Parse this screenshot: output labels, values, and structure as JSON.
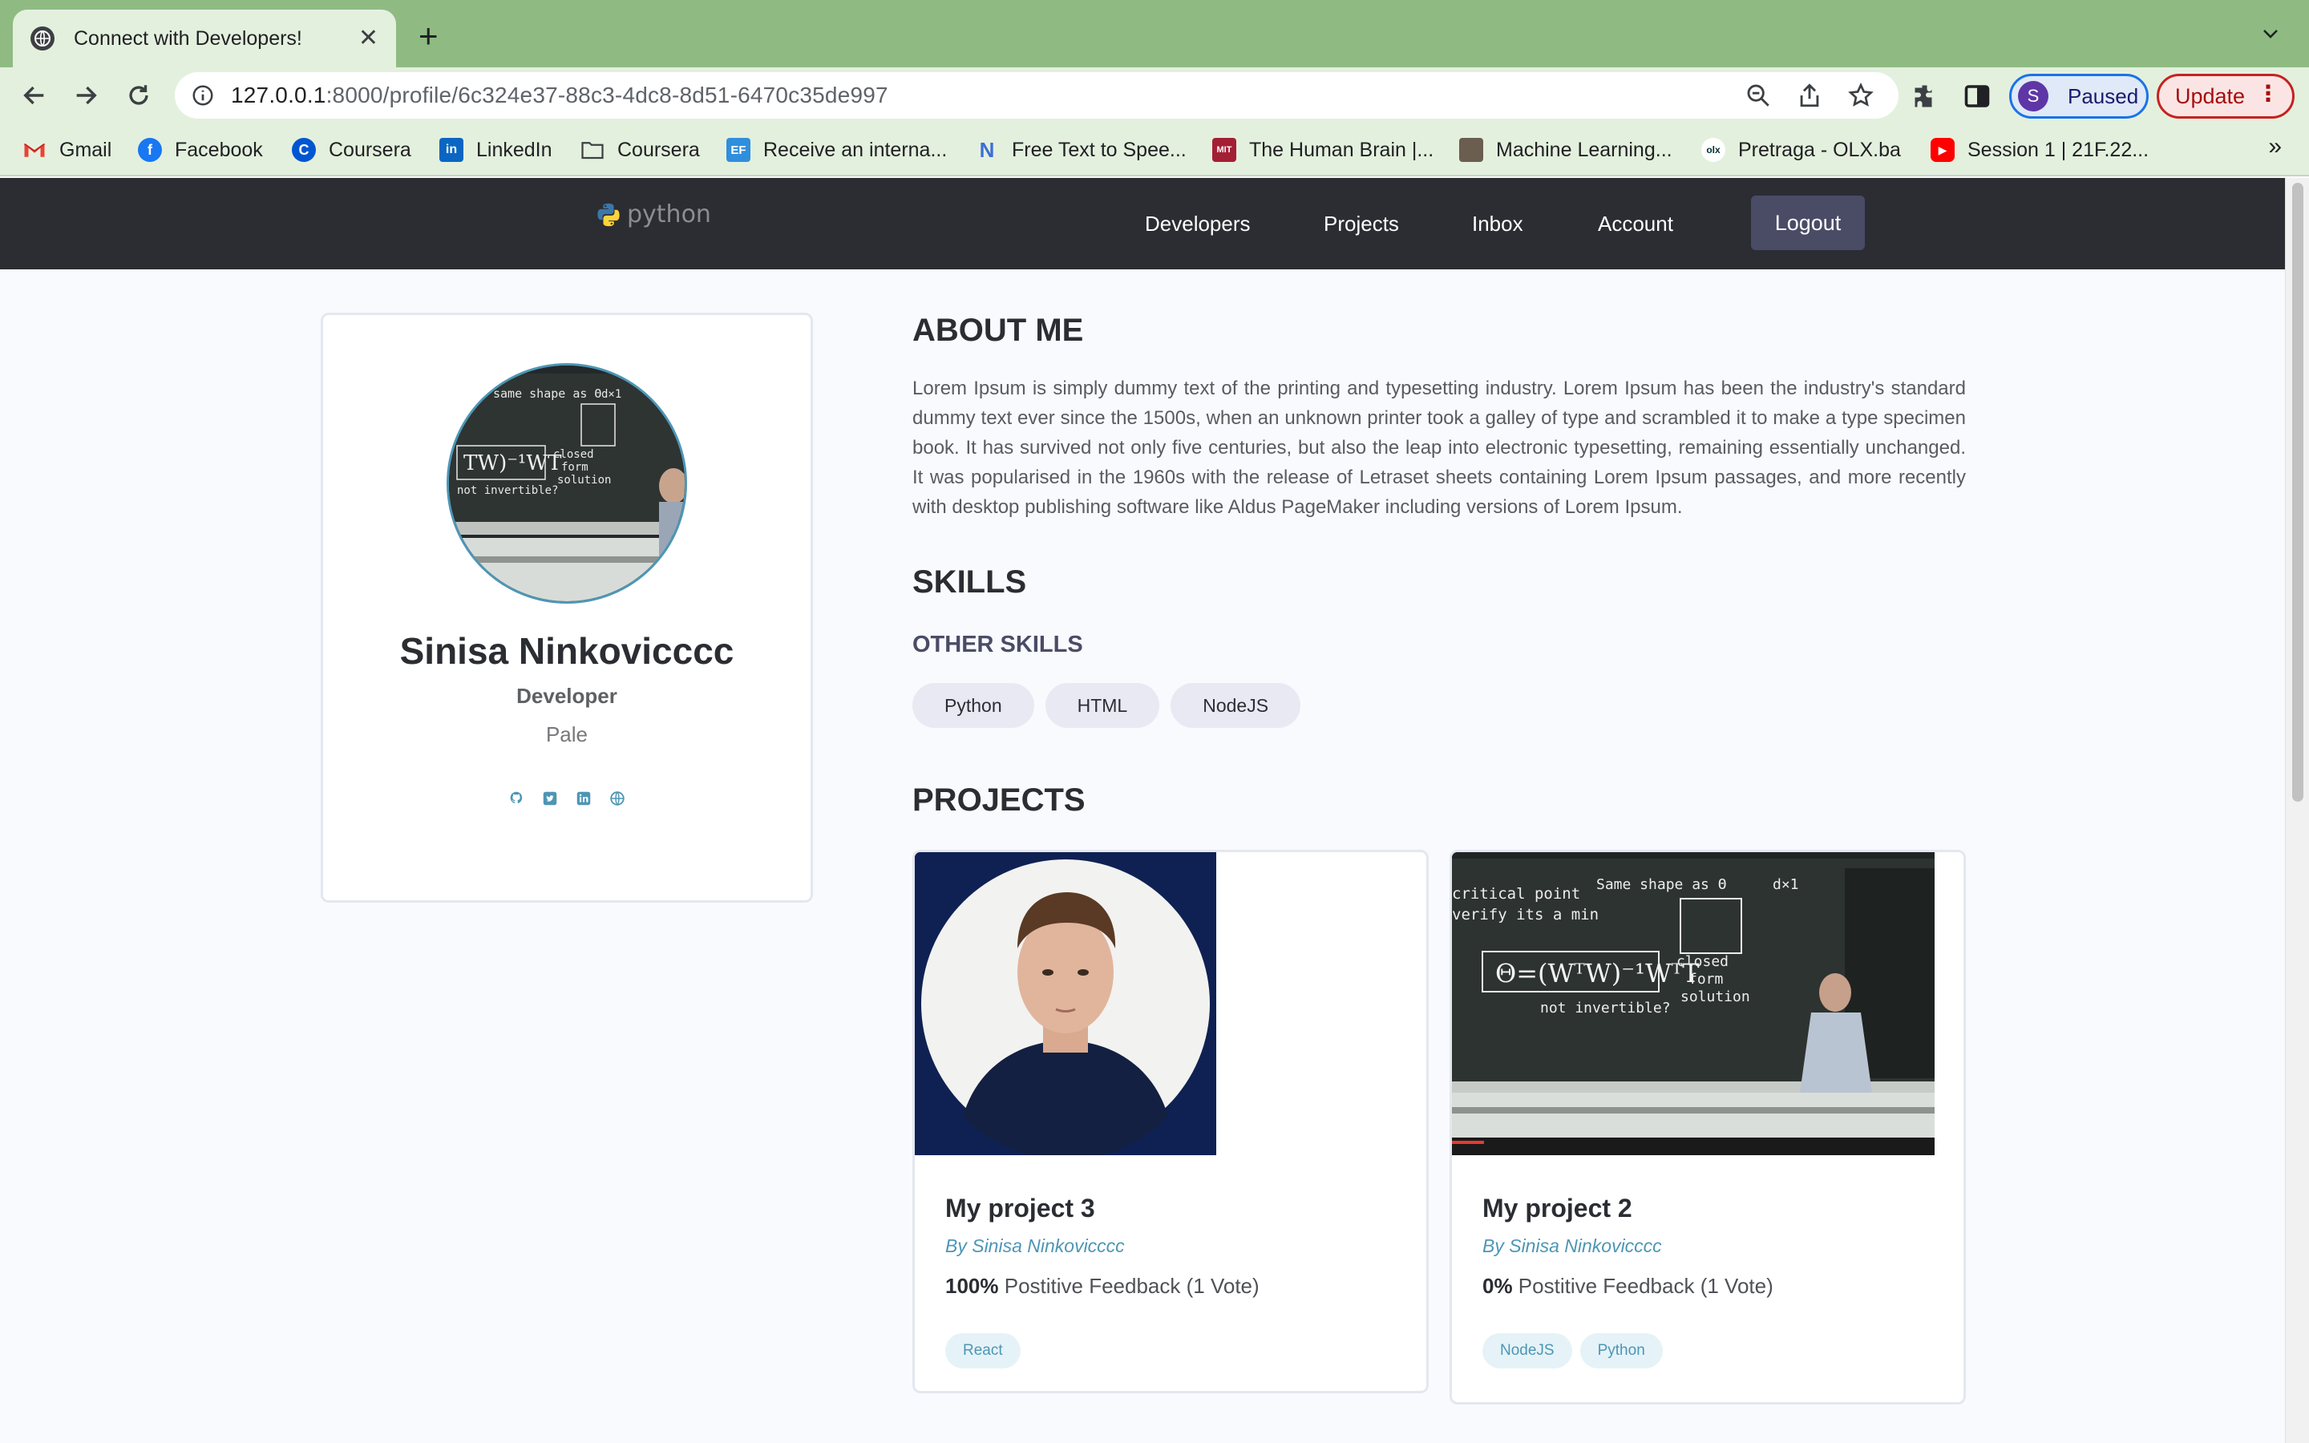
{
  "browser": {
    "tab_title": "Connect with Developers!",
    "new_tab": "+",
    "url_host": "127.0.0.1",
    "url_rest": ":8000/profile/6c324e37-88c3-4dc8-8d51-6470c35de997",
    "profile_initial": "S",
    "profile_status": "Paused",
    "update_label": "Update",
    "bookmarks": [
      {
        "label": "Gmail",
        "icon": "gmail-icon"
      },
      {
        "label": "Facebook",
        "icon": "facebook-icon"
      },
      {
        "label": "Coursera",
        "icon": "coursera-icon"
      },
      {
        "label": "LinkedIn",
        "icon": "linkedin-icon"
      },
      {
        "label": "Coursera",
        "icon": "folder-icon"
      },
      {
        "label": "Receive an interna...",
        "icon": "ef-icon"
      },
      {
        "label": "Free Text to Spee...",
        "icon": "n-icon"
      },
      {
        "label": "The Human Brain |...",
        "icon": "mit-icon"
      },
      {
        "label": "Machine Learning...",
        "icon": "photo-icon"
      },
      {
        "label": "Pretraga - OLX.ba",
        "icon": "olx-icon"
      },
      {
        "label": "Session 1 | 21F.22...",
        "icon": "youtube-icon"
      }
    ],
    "bookmarks_more": "»"
  },
  "site": {
    "logo_text": "python",
    "nav": [
      "Developers",
      "Projects",
      "Inbox",
      "Account"
    ],
    "logout": "Logout"
  },
  "profile": {
    "name": "Sinisa Ninkovicccc",
    "role": "Developer",
    "location": "Pale",
    "socials": [
      "github-icon",
      "twitter-icon",
      "linkedin-icon",
      "website-icon"
    ]
  },
  "about": {
    "heading": "ABOUT ME",
    "text": "Lorem Ipsum is simply dummy text of the printing and typesetting industry. Lorem Ipsum has been the industry's standard dummy text ever since the 1500s, when an unknown printer took a galley of type and scrambled it to make a type specimen book. It has survived not only five centuries, but also the leap into electronic typesetting, remaining essentially unchanged. It was popularised in the 1960s with the release of Letraset sheets containing Lorem Ipsum passages, and more recently with desktop publishing software like Aldus PageMaker including versions of Lorem Ipsum."
  },
  "skills": {
    "heading": "SKILLS",
    "other_heading": "OTHER SKILLS",
    "tags": [
      "Python",
      "HTML",
      "NodeJS"
    ]
  },
  "projects": {
    "heading": "PROJECTS",
    "items": [
      {
        "title": "My project 3",
        "by": "By Sinisa Ninkovicccc",
        "percent": "100%",
        "feedback": " Postitive Feedback (1 Vote)",
        "tags": [
          "React"
        ]
      },
      {
        "title": "My project 2",
        "by": "By Sinisa Ninkovicccc",
        "percent": "0%",
        "feedback": " Postitive Feedback (1 Vote)",
        "tags": [
          "NodeJS",
          "Python"
        ]
      }
    ]
  },
  "colors": {
    "tabbar": "#8fbb83",
    "toolbar": "#e4f0de",
    "nav_bg": "#2b2d33",
    "accent": "#4d96b5",
    "logout_bg": "#4a4c66"
  }
}
